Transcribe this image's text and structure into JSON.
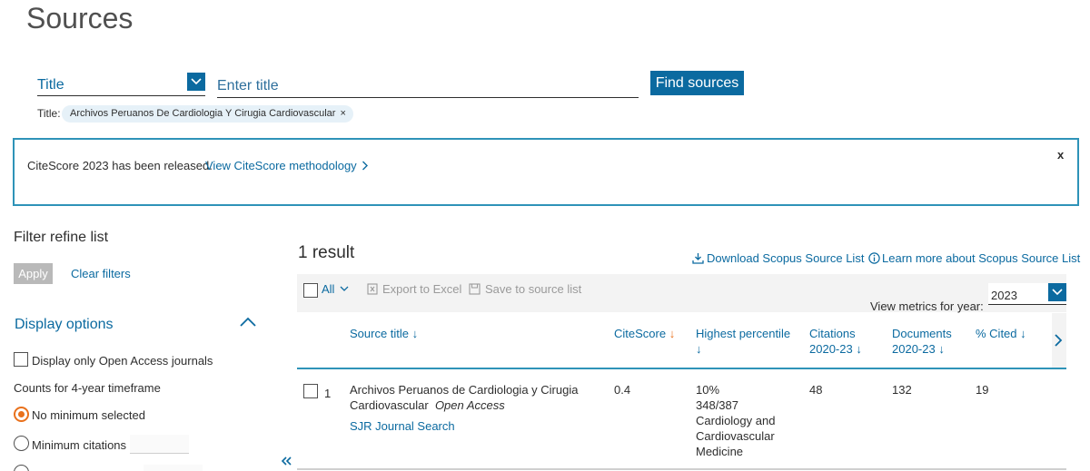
{
  "page": {
    "title": "Sources"
  },
  "search": {
    "field_label": "Title",
    "placeholder": "Enter title",
    "button_label": "Find sources",
    "chip_label": "Title:",
    "chip_value": "Archivos Peruanos De Cardiologia Y Cirugia Cardiovascular",
    "chip_remove": "×"
  },
  "banner": {
    "text": "CiteScore 2023 has been released.",
    "link": "View CiteScore methodology",
    "close": "x"
  },
  "filters": {
    "title": "Filter refine list",
    "apply_label": "Apply",
    "clear_label": "Clear filters",
    "display_options_label": "Display options",
    "open_access_label": "Display only Open Access journals",
    "counts_label": "Counts for 4-year timeframe",
    "radio_no_min": "No minimum selected",
    "radio_min_citations": "Minimum citations"
  },
  "results": {
    "count_label": "1 result",
    "download_link": "Download Scopus Source List",
    "learn_link": "Learn more about Scopus Source List",
    "toolbar": {
      "all_label": "All",
      "export_label": "Export to Excel",
      "save_label": "Save to source list",
      "view_metrics_label": "View metrics for year:",
      "year_value": "2023"
    },
    "columns": {
      "source_title": "Source title ↓",
      "citescore": "CiteScore",
      "citescore_arrow": "↓",
      "highest_percentile_1": "Highest percentile",
      "highest_percentile_2": "↓",
      "citations_1": "Citations",
      "citations_2": "2020-23 ↓",
      "documents_1": "Documents",
      "documents_2": "2020-23 ↓",
      "cited": "% Cited ↓"
    },
    "rows": [
      {
        "num": "1",
        "title_line1": "Archivos Peruanos de Cardiologia y Cirugia",
        "title_line2": "Cardiovascular",
        "open_access": "Open Access",
        "sjr_link": "SJR Journal Search",
        "citescore": "0.4",
        "percentile": "10%",
        "rank": "348/387",
        "category_1": "Cardiology and",
        "category_2": "Cardiovascular",
        "category_3": "Medicine",
        "citations": "48",
        "documents": "132",
        "cited": "19"
      }
    ]
  }
}
